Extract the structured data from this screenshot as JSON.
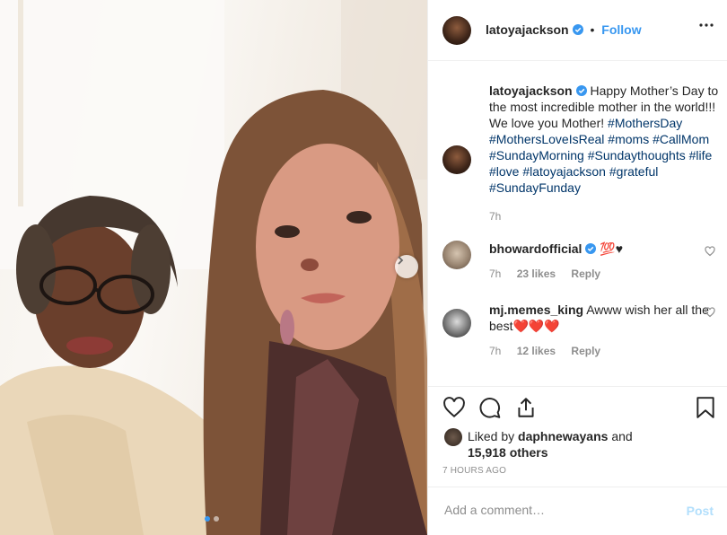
{
  "post": {
    "author": "latoyajackson",
    "follow_label": "Follow",
    "separator": "•",
    "carousel": {
      "total": 2,
      "active": 1
    }
  },
  "caption": {
    "username": "latoyajackson",
    "text": "Happy Mother’s Day to the most incredible mother in the world!!! We love you Mother!",
    "hashtags": [
      "#MothersDay",
      "#MothersLoveIsReal",
      "#moms",
      "#CallMom",
      "#SundayMorning",
      "#Sundaythoughts",
      "#life",
      "#love",
      "#latoyajackson",
      "#grateful",
      "#SundayFunday"
    ],
    "time": "7h"
  },
  "comments": [
    {
      "username": "bhowardofficial",
      "verified": true,
      "text": "💯♥",
      "time": "7h",
      "likes": "23 likes",
      "reply_label": "Reply"
    },
    {
      "username": "mj.memes_king",
      "verified": false,
      "text": "Awww wish her all the best❤️❤️❤️",
      "time": "7h",
      "likes": "12 likes",
      "reply_label": "Reply"
    }
  ],
  "likes": {
    "prefix": "Liked by",
    "user": "daphnewayans",
    "and": "and",
    "count": "15,918 others"
  },
  "timestamp": "7 HOURS AGO",
  "add_comment": {
    "placeholder": "Add a comment…",
    "post_label": "Post"
  },
  "colors": {
    "link": "#3897f0",
    "hashtag": "#003569",
    "muted": "#8e8e8e",
    "post_disabled": "#b2dffc"
  },
  "icons": [
    "more-icon",
    "verified-badge-icon",
    "heart-icon",
    "comment-icon",
    "share-icon",
    "bookmark-icon",
    "chevron-right-icon"
  ]
}
